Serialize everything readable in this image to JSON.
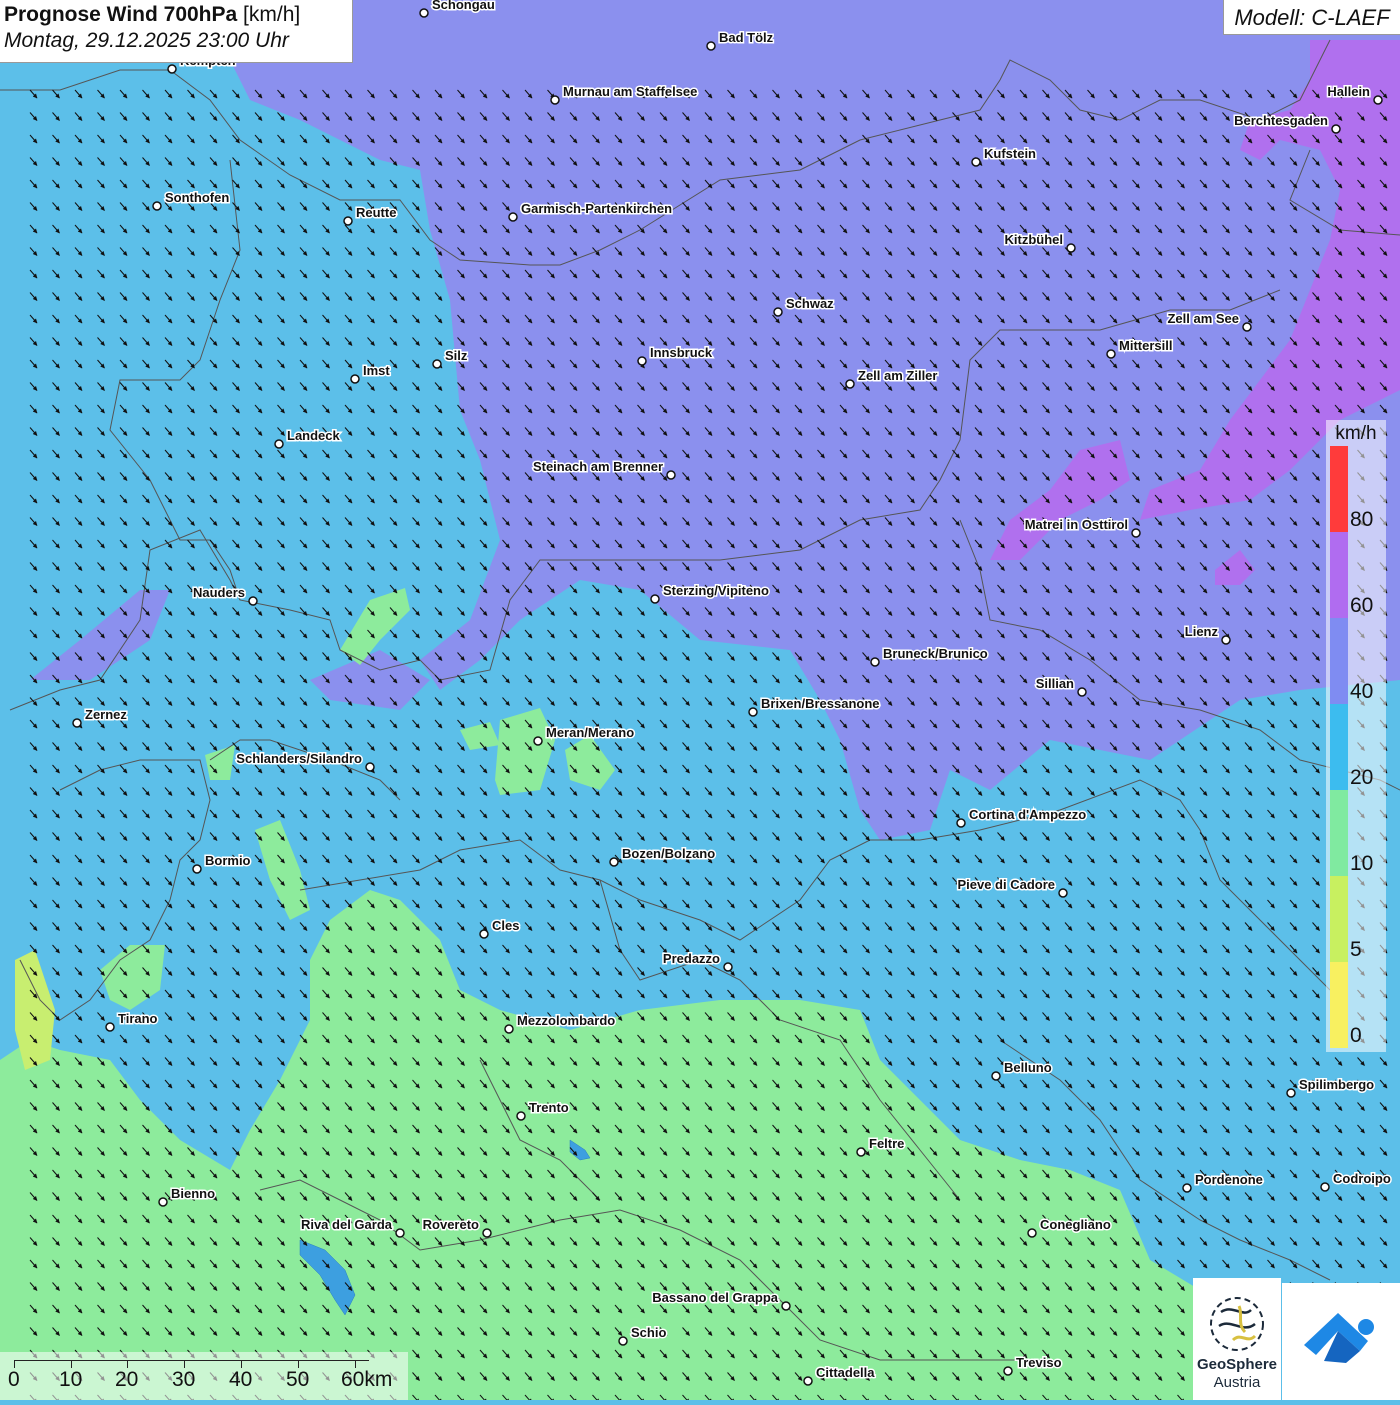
{
  "title": {
    "main": "Prognose Wind 700hPa",
    "unit": "[km/h]",
    "datetime": "Montag, 29.12.2025 23:00 Uhr"
  },
  "model": "Modell: C-LAEF",
  "legend": {
    "unit": "km/h",
    "labels": [
      "80",
      "60",
      "40",
      "20",
      "10",
      "5",
      "0"
    ],
    "colors": [
      "#ff3b3b",
      "#ea64ea",
      "#b06cf0",
      "#7f8cf2",
      "#3cbcef",
      "#80eaa0",
      "#c8f060",
      "#f8f060"
    ]
  },
  "scale": {
    "labels": [
      "0",
      "10",
      "20",
      "30",
      "40",
      "50",
      "60km"
    ]
  },
  "wind_direction": "north-west (arrows pointing south-east)",
  "cities": [
    {
      "name": "Schongau",
      "label": "Schongau"
    },
    {
      "name": "Bad Tölz",
      "label": "Bad Tölz"
    },
    {
      "name": "Kempten",
      "label": "Kempten"
    },
    {
      "name": "Murnau am Staffelsee",
      "label": "Murnau am Staffelsee"
    },
    {
      "name": "Hallein",
      "label": "Hallein"
    },
    {
      "name": "Berchtesgaden",
      "label": "Berchtesgaden"
    },
    {
      "name": "Kufstein",
      "label": "Kufstein"
    },
    {
      "name": "Sonthofen",
      "label": "Sonthofen"
    },
    {
      "name": "Reutte",
      "label": "Reutte"
    },
    {
      "name": "Garmisch-Partenkirchen",
      "label": "Garmisch-Partenkirchen"
    },
    {
      "name": "Kitzbühel",
      "label": "Kitzbühel"
    },
    {
      "name": "Schwaz",
      "label": "Schwaz"
    },
    {
      "name": "Zell am See",
      "label": "Zell am See"
    },
    {
      "name": "Mittersill",
      "label": "Mittersill"
    },
    {
      "name": "Innsbruck",
      "label": "Innsbruck"
    },
    {
      "name": "Silz",
      "label": "Silz"
    },
    {
      "name": "Imst",
      "label": "Imst"
    },
    {
      "name": "Zell am Ziller",
      "label": "Zell am Ziller"
    },
    {
      "name": "Landeck",
      "label": "Landeck"
    },
    {
      "name": "Steinach am Brenner",
      "label": "Steinach am Brenner"
    },
    {
      "name": "Matrei in Osttirol",
      "label": "Matrei in Osttirol"
    },
    {
      "name": "Nauders",
      "label": "Nauders"
    },
    {
      "name": "Sterzing/Vipiteno",
      "label": "Sterzing/Vipiteno"
    },
    {
      "name": "Lienz",
      "label": "Lienz"
    },
    {
      "name": "Bruneck/Brunico",
      "label": "Bruneck/Brunico"
    },
    {
      "name": "Sillian",
      "label": "Sillian"
    },
    {
      "name": "Zernez",
      "label": "Zernez"
    },
    {
      "name": "Brixen/Bressanone",
      "label": "Brixen/Bressanone"
    },
    {
      "name": "Meran/Merano",
      "label": "Meran/Merano"
    },
    {
      "name": "Schlanders/Silandro",
      "label": "Schlanders/Silandro"
    },
    {
      "name": "Cortina d'Ampezzo",
      "label": "Cortina d'Ampezzo"
    },
    {
      "name": "Bozen/Bolzano",
      "label": "Bozen/Bolzano"
    },
    {
      "name": "Bormio",
      "label": "Bormio"
    },
    {
      "name": "Pieve di Cadore",
      "label": "Pieve di Cadore"
    },
    {
      "name": "Cles",
      "label": "Cles"
    },
    {
      "name": "Predazzo",
      "label": "Predazzo"
    },
    {
      "name": "Tirano",
      "label": "Tirano"
    },
    {
      "name": "Mezzolombardo",
      "label": "Mezzolombardo"
    },
    {
      "name": "Belluno",
      "label": "Belluno"
    },
    {
      "name": "Spilimbergo",
      "label": "Spilimbergo"
    },
    {
      "name": "Trento",
      "label": "Trento"
    },
    {
      "name": "Feltre",
      "label": "Feltre"
    },
    {
      "name": "Pordenone",
      "label": "Pordenone"
    },
    {
      "name": "Codroipo",
      "label": "Codroipo"
    },
    {
      "name": "Bienno",
      "label": "Bienno"
    },
    {
      "name": "Riva del Garda",
      "label": "Riva del Garda"
    },
    {
      "name": "Rovereto",
      "label": "Rovereto"
    },
    {
      "name": "Conegliano",
      "label": "Conegliano"
    },
    {
      "name": "Bassano del Grappa",
      "label": "Bassano del Grappa"
    },
    {
      "name": "Schio",
      "label": "Schio"
    },
    {
      "name": "Treviso",
      "label": "Treviso"
    },
    {
      "name": "Cittadella",
      "label": "Cittadella"
    }
  ],
  "logo": {
    "line1": "GeoSphere",
    "line2": "Austria"
  }
}
